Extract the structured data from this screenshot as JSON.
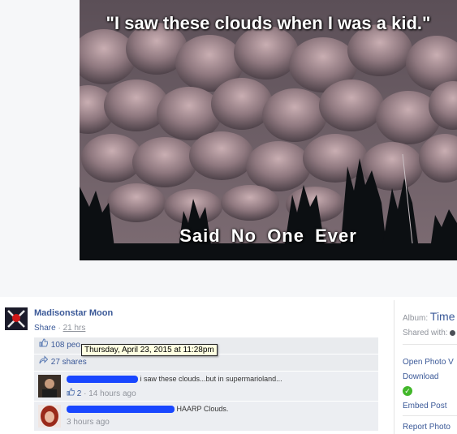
{
  "photo": {
    "caption_top": "\"I saw these clouds when I was a kid.\"",
    "caption_bottom": "Said No One Ever"
  },
  "post": {
    "owner_name": "Madisonstar Moon",
    "share_label": "Share",
    "separator": "·",
    "time_ago": "21 hrs"
  },
  "ufi": {
    "likes_text": "108 peo",
    "shares_text": "27 shares"
  },
  "tooltip": {
    "text": "Thursday, April 23, 2015 at 11:28pm"
  },
  "comments": [
    {
      "text": "i saw these clouds...but in supermarioland...",
      "likes": "2",
      "separator": "·",
      "time": "14 hours ago"
    },
    {
      "text": "HAARP Clouds.",
      "time": "3 hours ago"
    }
  ],
  "sidebar": {
    "album_label": "Album:",
    "album_value": "Time",
    "shared_with_label": "Shared with:",
    "open_photo_viewer": "Open Photo V",
    "download": "Download",
    "embed_post": "Embed Post",
    "report_photo": "Report Photo"
  },
  "colors": {
    "link_blue": "#3b5998",
    "redaction_blue": "#1947ff",
    "ufi_gray": "#e9ebee"
  }
}
